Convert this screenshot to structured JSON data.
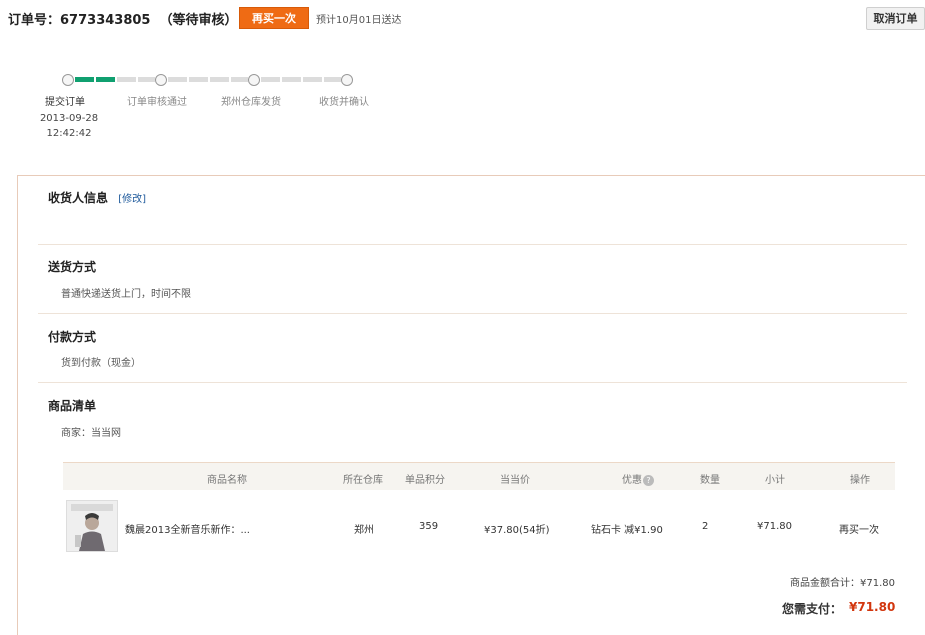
{
  "header": {
    "order_label": "订单号：",
    "order_number": "6773343805",
    "status": "（等待审核）",
    "rebuy_label": "再买一次",
    "eta": "预计10月01日送达",
    "cancel_label": "取消订单"
  },
  "progress": {
    "steps": [
      {
        "label": "提交订单",
        "date": "2013-09-28",
        "time": "12:42:42"
      },
      {
        "label": "订单审核通过"
      },
      {
        "label": "郑州仓库发货"
      },
      {
        "label": "收货并确认"
      }
    ]
  },
  "receiver": {
    "title": "收货人信息",
    "edit": "[修改]"
  },
  "shipping": {
    "title": "送货方式",
    "text": "普通快递送货上门，时间不限"
  },
  "payment": {
    "title": "付款方式",
    "text": "货到付款（现金）"
  },
  "goods": {
    "title": "商品清单",
    "seller": "商家：当当网",
    "columns": [
      "商品名称",
      "所在仓库",
      "单品积分",
      "当当价",
      "优惠",
      "数量",
      "小计",
      "操作"
    ],
    "rows": [
      {
        "name": "魏晨2013全新音乐新作：...",
        "warehouse": "郑州",
        "points": "359",
        "price": "¥37.80(54折)",
        "discount": "钻石卡 减¥1.90",
        "qty": "2",
        "subtotal": "¥71.80",
        "action": "再买一次"
      }
    ],
    "subtotal_text": "商品金额合计：¥71.80",
    "pay_label": "您需支付：",
    "pay_amount": "¥71.80",
    "help_icon": "?"
  }
}
